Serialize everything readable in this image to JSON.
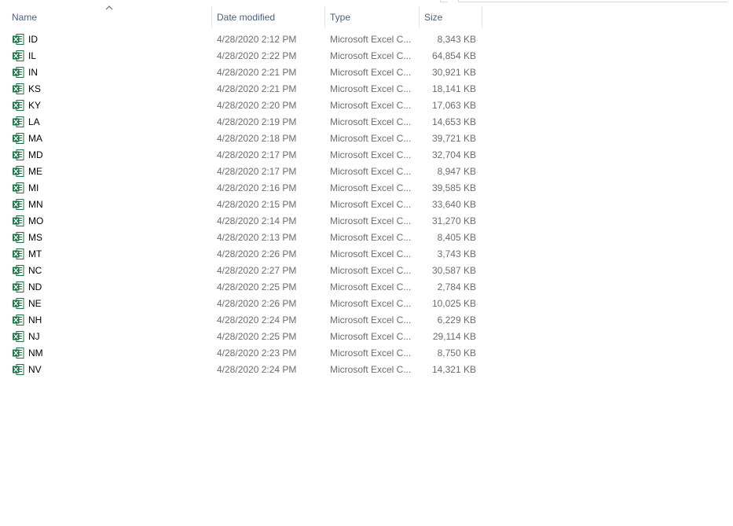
{
  "columns": {
    "name": "Name",
    "date_modified": "Date modified",
    "type": "Type",
    "size": "Size"
  },
  "sort": {
    "column": "name",
    "direction": "ascending"
  },
  "colors": {
    "excel_green": "#1e7145",
    "header_text": "#4c607a",
    "detail_text": "#6d6d6d"
  },
  "files": [
    {
      "name": "ID",
      "date": "4/28/2020 2:12 PM",
      "type": "Microsoft Excel C...",
      "size": "8,343 KB"
    },
    {
      "name": "IL",
      "date": "4/28/2020 2:22 PM",
      "type": "Microsoft Excel C...",
      "size": "64,854 KB"
    },
    {
      "name": "IN",
      "date": "4/28/2020 2:21 PM",
      "type": "Microsoft Excel C...",
      "size": "30,921 KB"
    },
    {
      "name": "KS",
      "date": "4/28/2020 2:21 PM",
      "type": "Microsoft Excel C...",
      "size": "18,141 KB"
    },
    {
      "name": "KY",
      "date": "4/28/2020 2:20 PM",
      "type": "Microsoft Excel C...",
      "size": "17,063 KB"
    },
    {
      "name": "LA",
      "date": "4/28/2020 2:19 PM",
      "type": "Microsoft Excel C...",
      "size": "14,653 KB"
    },
    {
      "name": "MA",
      "date": "4/28/2020 2:18 PM",
      "type": "Microsoft Excel C...",
      "size": "39,721 KB"
    },
    {
      "name": "MD",
      "date": "4/28/2020 2:17 PM",
      "type": "Microsoft Excel C...",
      "size": "32,704 KB"
    },
    {
      "name": "ME",
      "date": "4/28/2020 2:17 PM",
      "type": "Microsoft Excel C...",
      "size": "8,947 KB"
    },
    {
      "name": "MI",
      "date": "4/28/2020 2:16 PM",
      "type": "Microsoft Excel C...",
      "size": "39,585 KB"
    },
    {
      "name": "MN",
      "date": "4/28/2020 2:15 PM",
      "type": "Microsoft Excel C...",
      "size": "33,640 KB"
    },
    {
      "name": "MO",
      "date": "4/28/2020 2:14 PM",
      "type": "Microsoft Excel C...",
      "size": "31,270 KB"
    },
    {
      "name": "MS",
      "date": "4/28/2020 2:13 PM",
      "type": "Microsoft Excel C...",
      "size": "8,405 KB"
    },
    {
      "name": "MT",
      "date": "4/28/2020 2:26 PM",
      "type": "Microsoft Excel C...",
      "size": "3,743 KB"
    },
    {
      "name": "NC",
      "date": "4/28/2020 2:27 PM",
      "type": "Microsoft Excel C...",
      "size": "30,587 KB"
    },
    {
      "name": "ND",
      "date": "4/28/2020 2:25 PM",
      "type": "Microsoft Excel C...",
      "size": "2,784 KB"
    },
    {
      "name": "NE",
      "date": "4/28/2020 2:26 PM",
      "type": "Microsoft Excel C...",
      "size": "10,025 KB"
    },
    {
      "name": "NH",
      "date": "4/28/2020 2:24 PM",
      "type": "Microsoft Excel C...",
      "size": "6,229 KB"
    },
    {
      "name": "NJ",
      "date": "4/28/2020 2:25 PM",
      "type": "Microsoft Excel C...",
      "size": "29,114 KB"
    },
    {
      "name": "NM",
      "date": "4/28/2020 2:23 PM",
      "type": "Microsoft Excel C...",
      "size": "8,750 KB"
    },
    {
      "name": "NV",
      "date": "4/28/2020 2:24 PM",
      "type": "Microsoft Excel C...",
      "size": "14,321 KB"
    }
  ]
}
